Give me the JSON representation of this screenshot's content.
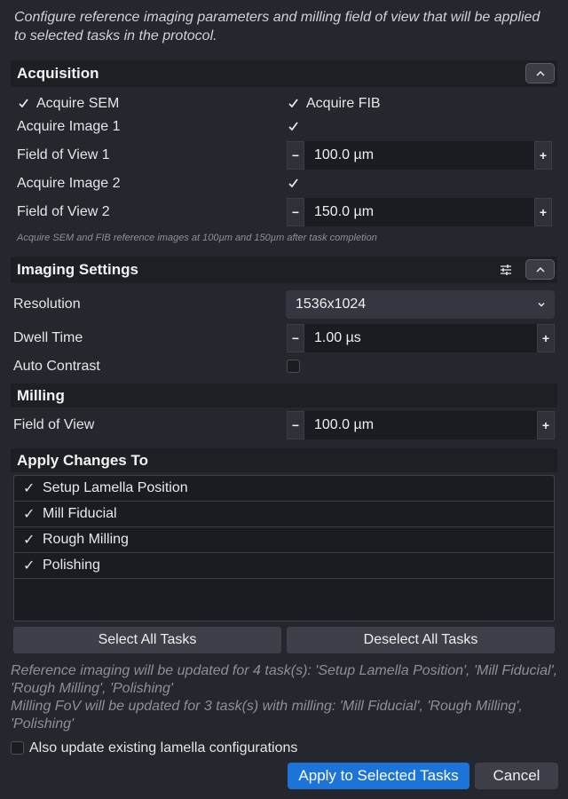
{
  "intro_text": "Configure reference imaging parameters and milling field of view that will be applied to selected tasks in the protocol.",
  "acquisition": {
    "title": "Acquisition",
    "acquire_sem": {
      "label": "Acquire SEM",
      "checked": true
    },
    "acquire_fib": {
      "label": "Acquire FIB",
      "checked": true
    },
    "acquire_image_1": {
      "label": "Acquire Image 1",
      "checked": true
    },
    "fov1": {
      "label": "Field of View 1",
      "value": "100.0  µm"
    },
    "acquire_image_2": {
      "label": "Acquire Image 2",
      "checked": true
    },
    "fov2": {
      "label": "Field of View 2",
      "value": "150.0  µm"
    },
    "hint": "Acquire SEM and FIB reference images at 100µm and 150µm after task completion"
  },
  "imaging": {
    "title": "Imaging Settings",
    "resolution": {
      "label": "Resolution",
      "value": "1536x1024"
    },
    "dwell_time": {
      "label": "Dwell Time",
      "value": "1.00 µs"
    },
    "auto_contrast": {
      "label": "Auto Contrast",
      "checked": false
    }
  },
  "milling": {
    "title": "Milling",
    "fov": {
      "label": "Field of View",
      "value": "100.0 µm"
    }
  },
  "apply": {
    "title": "Apply Changes To",
    "tasks": [
      {
        "label": "Setup Lamella Position",
        "checked": true
      },
      {
        "label": "Mill Fiducial",
        "checked": true
      },
      {
        "label": "Rough Milling",
        "checked": true
      },
      {
        "label": "Polishing",
        "checked": true
      }
    ],
    "select_all": "Select All Tasks",
    "deselect_all": "Deselect All Tasks"
  },
  "summary": {
    "line1": "Reference imaging will be updated for 4 task(s): 'Setup Lamella Position', 'Mill Fiducial', 'Rough Milling', 'Polishing'",
    "line2": "Milling FoV will be updated for 3 task(s) with milling: 'Mill Fiducial', 'Rough Milling', 'Polishing'"
  },
  "update_existing": {
    "label": "Also update existing lamella configurations",
    "checked": false
  },
  "buttons": {
    "apply": "Apply to Selected Tasks",
    "cancel": "Cancel"
  },
  "spin_minus": "−",
  "spin_plus": "+",
  "colors": {
    "accent": "#1d74d8",
    "background": "#25272e",
    "header": "#1d1f24"
  }
}
